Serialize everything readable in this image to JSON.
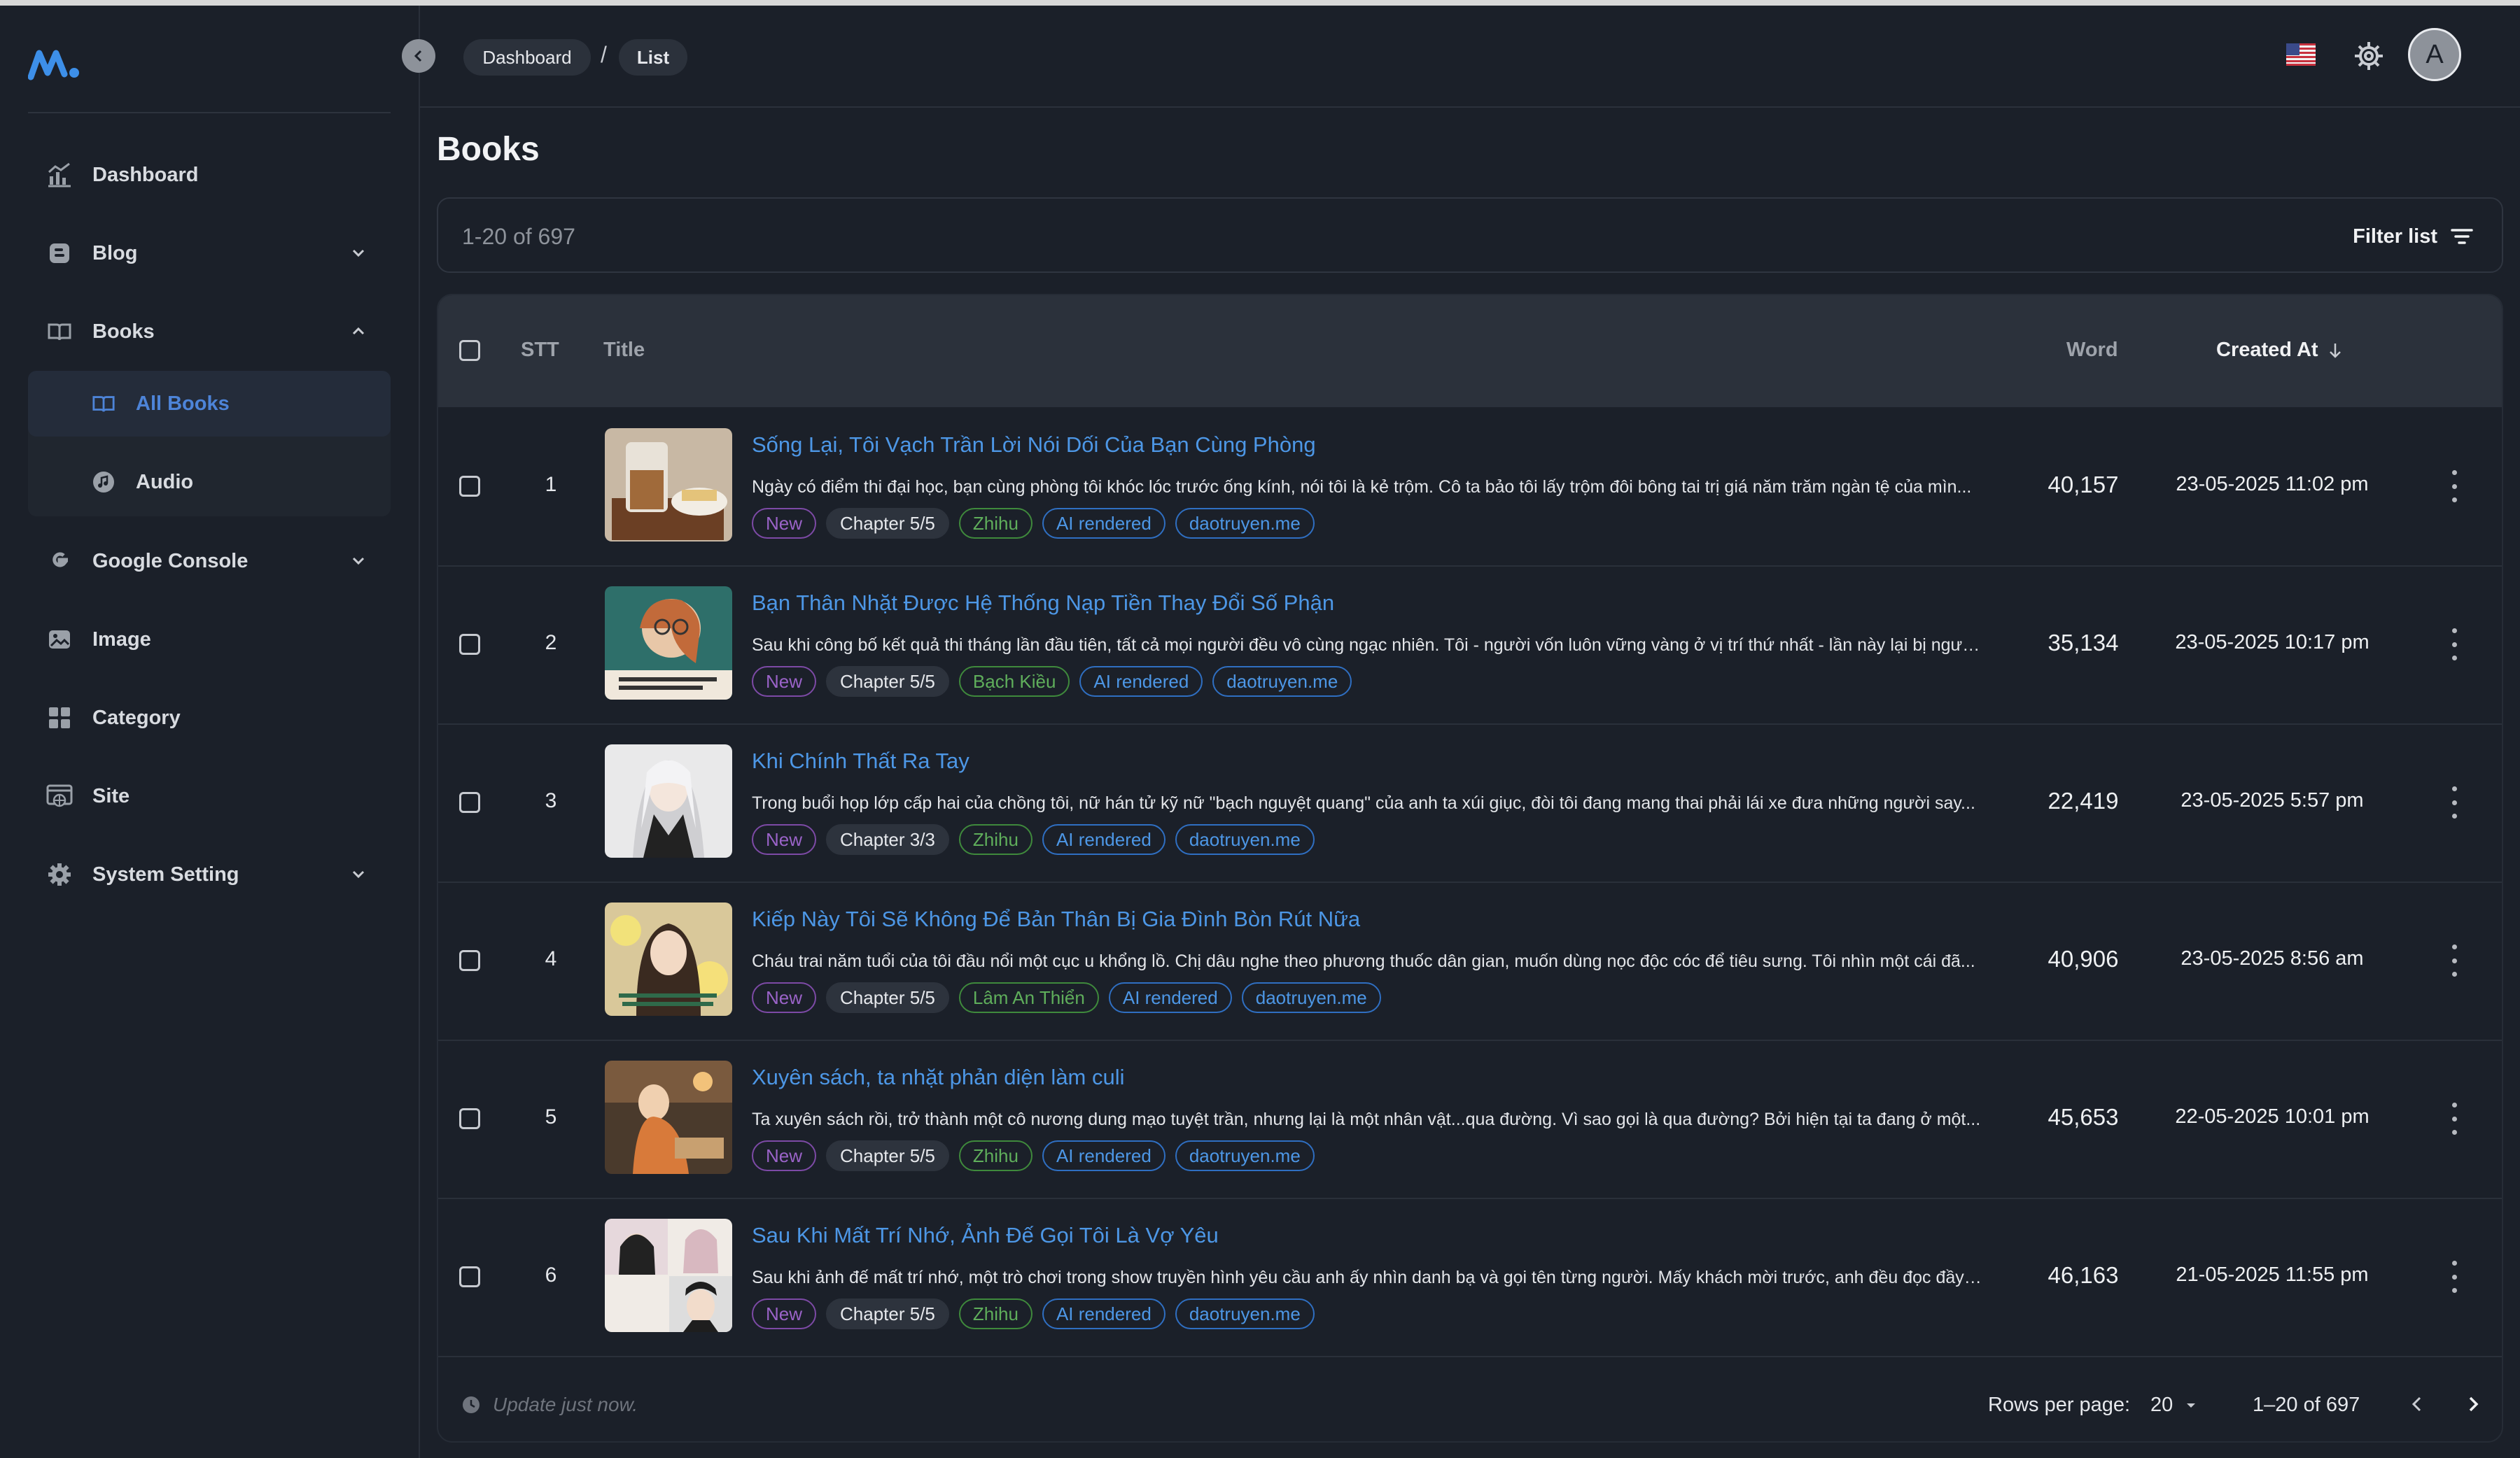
{
  "sidebar": {
    "items": [
      {
        "label": "Dashboard",
        "icon": "chart-icon"
      },
      {
        "label": "Blog",
        "icon": "blog-icon"
      },
      {
        "label": "Books",
        "icon": "book-icon"
      },
      {
        "label": "Google Console",
        "icon": "google-icon"
      },
      {
        "label": "Image",
        "icon": "image-icon"
      },
      {
        "label": "Category",
        "icon": "grid-icon"
      },
      {
        "label": "Site",
        "icon": "site-icon"
      },
      {
        "label": "System Setting",
        "icon": "gear-icon"
      }
    ],
    "books_sub": [
      {
        "label": "All Books",
        "icon": "book-icon",
        "active": true
      },
      {
        "label": "Audio",
        "icon": "music-icon",
        "active": false
      }
    ]
  },
  "header": {
    "breadcrumb": [
      "Dashboard",
      "List"
    ],
    "avatar_letter": "A"
  },
  "page": {
    "title": "Books",
    "count": "1-20 of 697",
    "filter_label": "Filter list"
  },
  "table": {
    "columns": {
      "stt": "STT",
      "title": "Title",
      "word": "Word",
      "created": "Created At"
    },
    "rows": [
      {
        "stt": "1",
        "title": "Sống Lại, Tôi Vạch Trần Lời Nói Dối Của Bạn Cùng Phòng",
        "desc": "Ngày có điểm thi đại học, bạn cùng phòng tôi khóc lóc trước ống kính, nói tôi là kẻ trộm. Cô ta bảo tôi lấy trộm đôi bông tai trị giá năm trăm ngàn tệ của mìn...",
        "tags": {
          "new": "New",
          "chapter": "Chapter 5/5",
          "source": "Zhihu",
          "ai": "AI rendered",
          "domain": "daotruyen.me"
        },
        "word": "40,157",
        "created": "23-05-2025 11:02 pm"
      },
      {
        "stt": "2",
        "title": "Bạn Thân Nhặt Được Hệ Thống Nạp Tiền Thay Đổi Số Phận",
        "desc": "Sau khi công bố kết quả thi tháng lần đầu tiên, tất cả mọi người đều vô cùng ngạc nhiên. Tôi - người vốn luôn vững vàng ở vị trí thứ nhất - lần này lại bị ngườ...",
        "tags": {
          "new": "New",
          "chapter": "Chapter 5/5",
          "source": "Bạch Kiều",
          "ai": "AI rendered",
          "domain": "daotruyen.me"
        },
        "word": "35,134",
        "created": "23-05-2025 10:17 pm"
      },
      {
        "stt": "3",
        "title": "Khi Chính Thất Ra Tay",
        "desc": "Trong buổi họp lớp cấp hai của chồng tôi, nữ hán tử kỹ nữ \"bạch nguyệt quang\" của anh ta xúi giục, đòi tôi đang mang thai phải lái xe đưa những người say...",
        "tags": {
          "new": "New",
          "chapter": "Chapter 3/3",
          "source": "Zhihu",
          "ai": "AI rendered",
          "domain": "daotruyen.me"
        },
        "word": "22,419",
        "created": "23-05-2025 5:57 pm"
      },
      {
        "stt": "4",
        "title": "Kiếp Này Tôi Sẽ Không Để Bản Thân Bị Gia Đình Bòn Rút Nữa",
        "desc": "Cháu trai năm tuổi của tôi đầu nổi một cục u khổng lồ. Chị dâu nghe theo phương thuốc dân gian, muốn dùng nọc độc cóc để tiêu sưng. Tôi nhìn một cái đã...",
        "tags": {
          "new": "New",
          "chapter": "Chapter 5/5",
          "source": "Lâm An Thiển",
          "ai": "AI rendered",
          "domain": "daotruyen.me"
        },
        "word": "40,906",
        "created": "23-05-2025 8:56 am"
      },
      {
        "stt": "5",
        "title": "Xuyên sách, ta nhặt phản diện làm culi",
        "desc": "Ta xuyên sách rồi, trở thành một cô nương dung mạo tuyệt trần, nhưng lại là một nhân vật...qua đường. Vì sao gọi là qua đường? Bởi hiện tại ta đang ở một...",
        "tags": {
          "new": "New",
          "chapter": "Chapter 5/5",
          "source": "Zhihu",
          "ai": "AI rendered",
          "domain": "daotruyen.me"
        },
        "word": "45,653",
        "created": "22-05-2025 10:01 pm"
      },
      {
        "stt": "6",
        "title": "Sau Khi Mất Trí Nhớ, Ảnh Đế Gọi Tôi Là Vợ Yêu",
        "desc": "Sau khi ảnh đế mất trí nhớ, một trò chơi trong show truyền hình yêu cầu anh ấy nhìn danh bạ và gọi tên từng người. Mấy khách mời trước, anh đều đọc đầy đ...",
        "tags": {
          "new": "New",
          "chapter": "Chapter 5/5",
          "source": "Zhihu",
          "ai": "AI rendered",
          "domain": "daotruyen.me"
        },
        "word": "46,163",
        "created": "21-05-2025 11:55 pm"
      }
    ]
  },
  "footer": {
    "update": "Update just now.",
    "rows_per_page_label": "Rows per page:",
    "rows_per_page": "20",
    "range": "1–20 of 697"
  },
  "colors": {
    "background": "#1b2029",
    "header_row": "#2b313b",
    "accent_blue": "#4d97e6",
    "tag_purple": "#9a63c8",
    "tag_green": "#5fae5b"
  }
}
